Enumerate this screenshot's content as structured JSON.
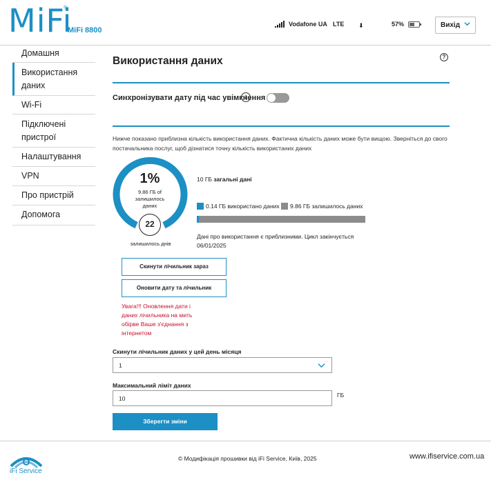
{
  "header": {
    "logo_text": "MiFi",
    "logo_tm": "®",
    "model": "MiFi 8800",
    "operator": "Vodafone UA",
    "network": "LTE",
    "battery": "57%",
    "battery_level": 0.57,
    "logout_label": "Вихід"
  },
  "sidebar": {
    "items": [
      {
        "label": "Домашня"
      },
      {
        "label": "Використання даних"
      },
      {
        "label": "Wi-Fi"
      },
      {
        "label": "Підключені пристрої"
      },
      {
        "label": "Налаштування"
      },
      {
        "label": "VPN"
      },
      {
        "label": "Про пристрій"
      },
      {
        "label": "Допомога"
      }
    ]
  },
  "main": {
    "title": "Використання даних",
    "help_glyph": "?",
    "sync_label": "Синхронізувати дату під час увімкнення",
    "info_glyph": "i",
    "notice": "Нижче показано приблизна кількість використання даних. Фактична кількість даних може бути вищою. Зверніться до свого постачальника послуг, щоб дізнатися точну кількість використаних даних",
    "usage": {
      "percent": "1%",
      "remaining_text": "9.86 ГБ of залишилось даних",
      "days": "22",
      "days_label": "залишилось днів",
      "total_value": "10 ГБ",
      "total_label": "загальні дані",
      "used_legend": "0.14 ГБ використано даних",
      "remaining_legend": "9.86 ГБ залишилось даних",
      "used_fraction": 0.014,
      "approx_note": "Дані про використання є приблизними. Цикл закінчується 06/01/2025"
    },
    "reset_button": "Скинути лічильник зараз",
    "update_button": "Оновити дату та лічильник",
    "warning": "Увага!!! Оновлення дати і даних лічильника на мить обірве Ваше з'єднання з інтернетом",
    "reset_day_label": "Скинути лічильник даних у цей день місяця",
    "reset_day_value": "1",
    "limit_label": "Максимальний ліміт даних",
    "limit_value": "10",
    "limit_unit": "ГБ",
    "save_button": "Зберегти зміни"
  },
  "footer": {
    "logo_text": "iFi Service",
    "copyright": "© Модифікація прошивки від iFi Service, Київ, 2025",
    "site": "www.ifiservice.com.ua"
  },
  "colors": {
    "accent": "#1c8fc4",
    "bar_remaining": "#8c8c8c",
    "warning": "#c8102e"
  }
}
